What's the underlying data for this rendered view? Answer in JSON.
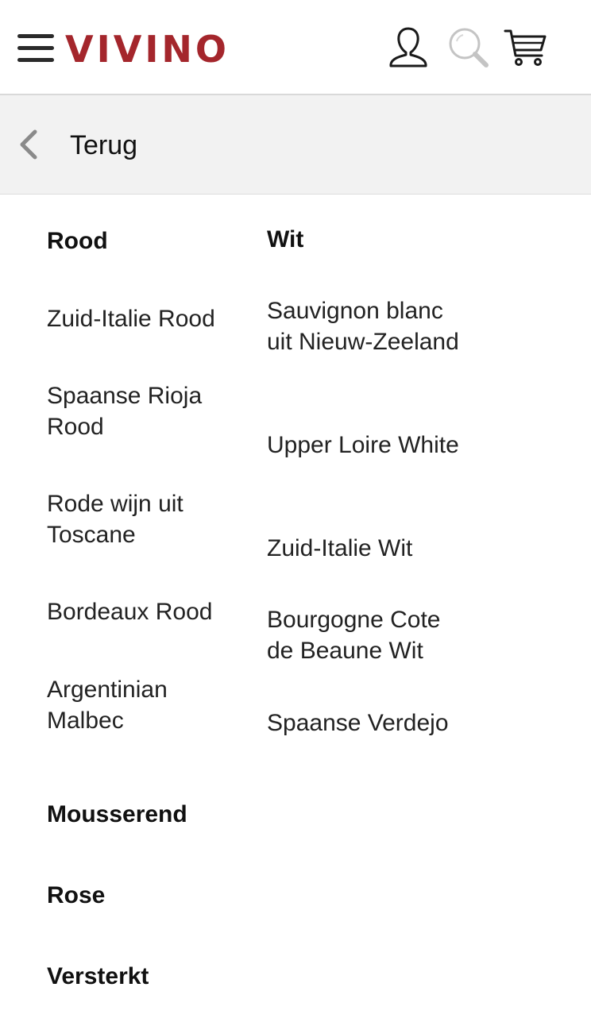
{
  "header": {
    "logo": "VIVINO",
    "menu_icon": "hamburger-menu-icon",
    "user_icon": "user-icon",
    "search_icon": "search-icon",
    "cart_icon": "cart-icon",
    "brand_color": "#a4262c"
  },
  "back": {
    "label": "Terug",
    "icon": "chevron-left-icon"
  },
  "categories": {
    "red": {
      "title": "Rood",
      "items": [
        "Zuid-Italie Rood",
        "Spaanse Rioja Rood",
        "Rode wijn uit Toscane",
        "Bordeaux Rood",
        "Argentinian Malbec"
      ]
    },
    "white": {
      "title": "Wit",
      "items": [
        "Sauvignon blanc uit Nieuw-Zeeland",
        "Upper Loire White",
        "Zuid-Italie Wit",
        "Bourgogne Cote de Beaune Wit",
        "Spaanse Verdejo"
      ]
    },
    "sparkling": {
      "title": "Mousserend"
    },
    "rose": {
      "title": "Rose"
    },
    "fortified": {
      "title": "Versterkt"
    }
  }
}
